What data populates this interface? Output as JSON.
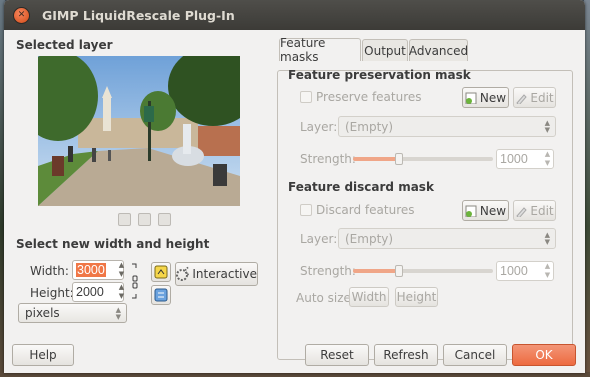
{
  "window": {
    "title": "GIMP LiquidRescale Plug-In"
  },
  "left": {
    "selected_layer_title": "Selected layer",
    "size_title": "Select new width and height",
    "width_label": "Width:",
    "width_value": "3000",
    "height_label": "Height:",
    "height_value": "2000",
    "unit_value": "pixels",
    "interactive_label": "Interactive"
  },
  "tabs": [
    {
      "label": "Feature masks",
      "active": true
    },
    {
      "label": "Output",
      "active": false
    },
    {
      "label": "Advanced",
      "active": false
    }
  ],
  "preservation": {
    "title": "Feature preservation mask",
    "checkbox_label": "Preserve features",
    "new_label": "New",
    "edit_label": "Edit",
    "layer_label": "Layer:",
    "layer_value": "(Empty)",
    "strength_label": "Strength:",
    "strength_value": "1000",
    "strength_fraction": 0.33
  },
  "discard": {
    "title": "Feature discard mask",
    "checkbox_label": "Discard features",
    "new_label": "New",
    "edit_label": "Edit",
    "layer_label": "Layer:",
    "layer_value": "(Empty)",
    "strength_label": "Strength:",
    "strength_value": "1000",
    "strength_fraction": 0.33,
    "auto_size_label": "Auto size:",
    "width_button": "Width",
    "height_button": "Height"
  },
  "footer": {
    "help": "Help",
    "reset": "Reset",
    "refresh": "Refresh",
    "cancel": "Cancel",
    "ok": "OK"
  },
  "colors": {
    "accent": "#ed6b40",
    "titlebar": "#3c3b37"
  }
}
